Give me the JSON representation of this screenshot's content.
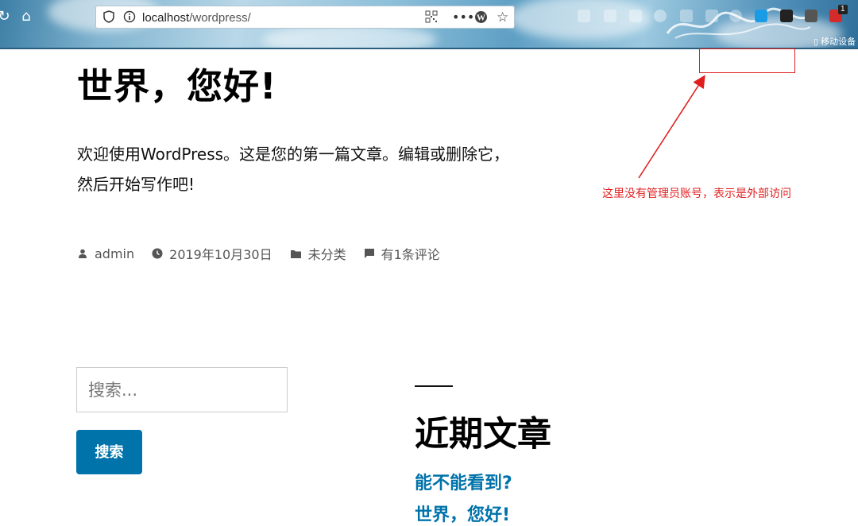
{
  "browser": {
    "url_host": "localhost",
    "url_path": "/wordpress/",
    "reload_icon": "reload-icon",
    "home_icon": "home-icon",
    "extension_badge": "1",
    "bookmark_label": "移动设备"
  },
  "post": {
    "title": "世界，您好!",
    "body": "欢迎使用WordPress。这是您的第一篇文章。编辑或删除它，然后开始写作吧!",
    "author": "admin",
    "date": "2019年10月30日",
    "category": "未分类",
    "comments": "有1条评论"
  },
  "search": {
    "placeholder": "搜索...",
    "button_label": "搜索"
  },
  "recent_posts": {
    "title": "近期文章",
    "items": [
      "能不能看到?",
      "世界，您好!"
    ]
  },
  "annotation": {
    "text": "这里没有管理员账号，表示是外部访问",
    "color": "#e02020"
  },
  "colors": {
    "link": "#0073aa",
    "button_bg": "#0073aa"
  }
}
